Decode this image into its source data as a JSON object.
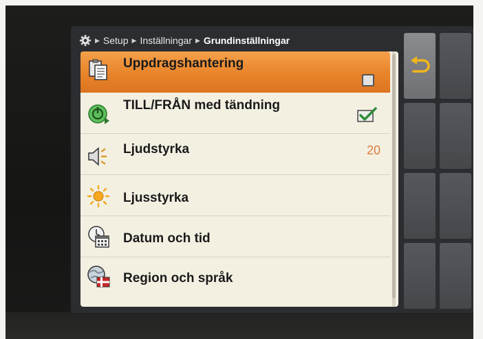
{
  "breadcrumb": {
    "items": [
      "Setup",
      "Inställningar"
    ],
    "current": "Grundinställningar"
  },
  "menu": {
    "items": [
      {
        "label": "Uppdragshantering",
        "icon": "task-management-icon",
        "control": "checkbox",
        "checked": false,
        "selected": true
      },
      {
        "label": "TILL/FRÅN med tändning",
        "icon": "power-ignition-icon",
        "control": "checkbox",
        "checked": true
      },
      {
        "label": "Ljudstyrka",
        "icon": "speaker-icon",
        "value": "20"
      },
      {
        "label": "Ljusstyrka",
        "icon": "brightness-sun-icon"
      },
      {
        "label": "Datum och tid",
        "icon": "calendar-clock-icon"
      },
      {
        "label": "Region och språk",
        "icon": "globe-flag-icon"
      }
    ]
  },
  "softkeys": {
    "back_icon": "back-arrow-icon"
  },
  "colors": {
    "selected_row": "#e8842a",
    "panel_bg": "#f3f0e2",
    "value_text": "#e07a3a",
    "screen_bg": "#2b2d30"
  }
}
